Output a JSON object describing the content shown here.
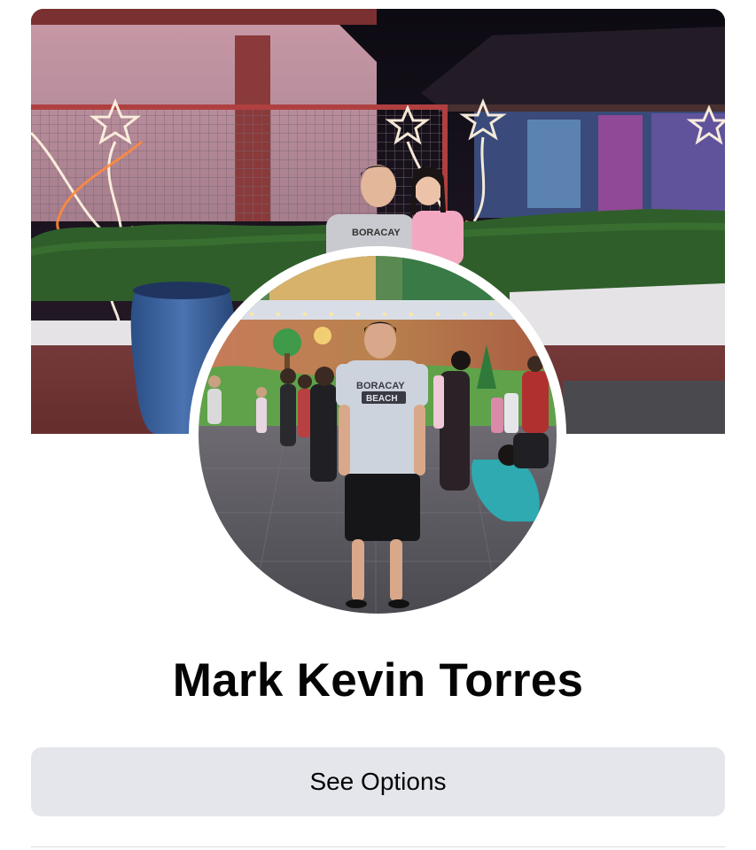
{
  "profile": {
    "name": "Mark Kevin Torres",
    "cover_shirt_text": "BORACAY",
    "avatar_shirt_text": "BORACAY",
    "avatar_shirt_subtext": "BEACH"
  },
  "actions": {
    "see_options_label": "See Options"
  },
  "colors": {
    "button_bg": "#e4e6eb",
    "text_primary": "#050505",
    "background": "#ffffff"
  }
}
